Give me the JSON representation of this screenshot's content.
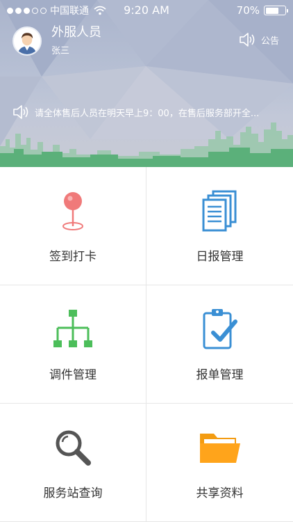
{
  "status_bar": {
    "carrier": "中国联通",
    "time": "9:20 AM",
    "battery": "70%",
    "battery_level": 0.7
  },
  "profile": {
    "role": "外服人员",
    "name": "张三"
  },
  "notice": {
    "button_label": "公告",
    "ticker_text": "请全体售后人员在明天早上9：00，在售后服务部开全..."
  },
  "menu": {
    "items": [
      {
        "label": "签到打卡",
        "icon": "map-pin-icon",
        "color": "#f07a7a"
      },
      {
        "label": "日报管理",
        "icon": "documents-icon",
        "color": "#3a8fd4"
      },
      {
        "label": "调件管理",
        "icon": "org-chart-icon",
        "color": "#4cbe5a"
      },
      {
        "label": "报单管理",
        "icon": "clipboard-check-icon",
        "color": "#3a8fd4"
      },
      {
        "label": "服务站查询",
        "icon": "magnifier-icon",
        "color": "#555555"
      },
      {
        "label": "共享资料",
        "icon": "folder-icon",
        "color": "#ffa41b"
      }
    ]
  },
  "colors": {
    "header_bg": "#b7c0d4",
    "city_green": "#5bb07a"
  }
}
